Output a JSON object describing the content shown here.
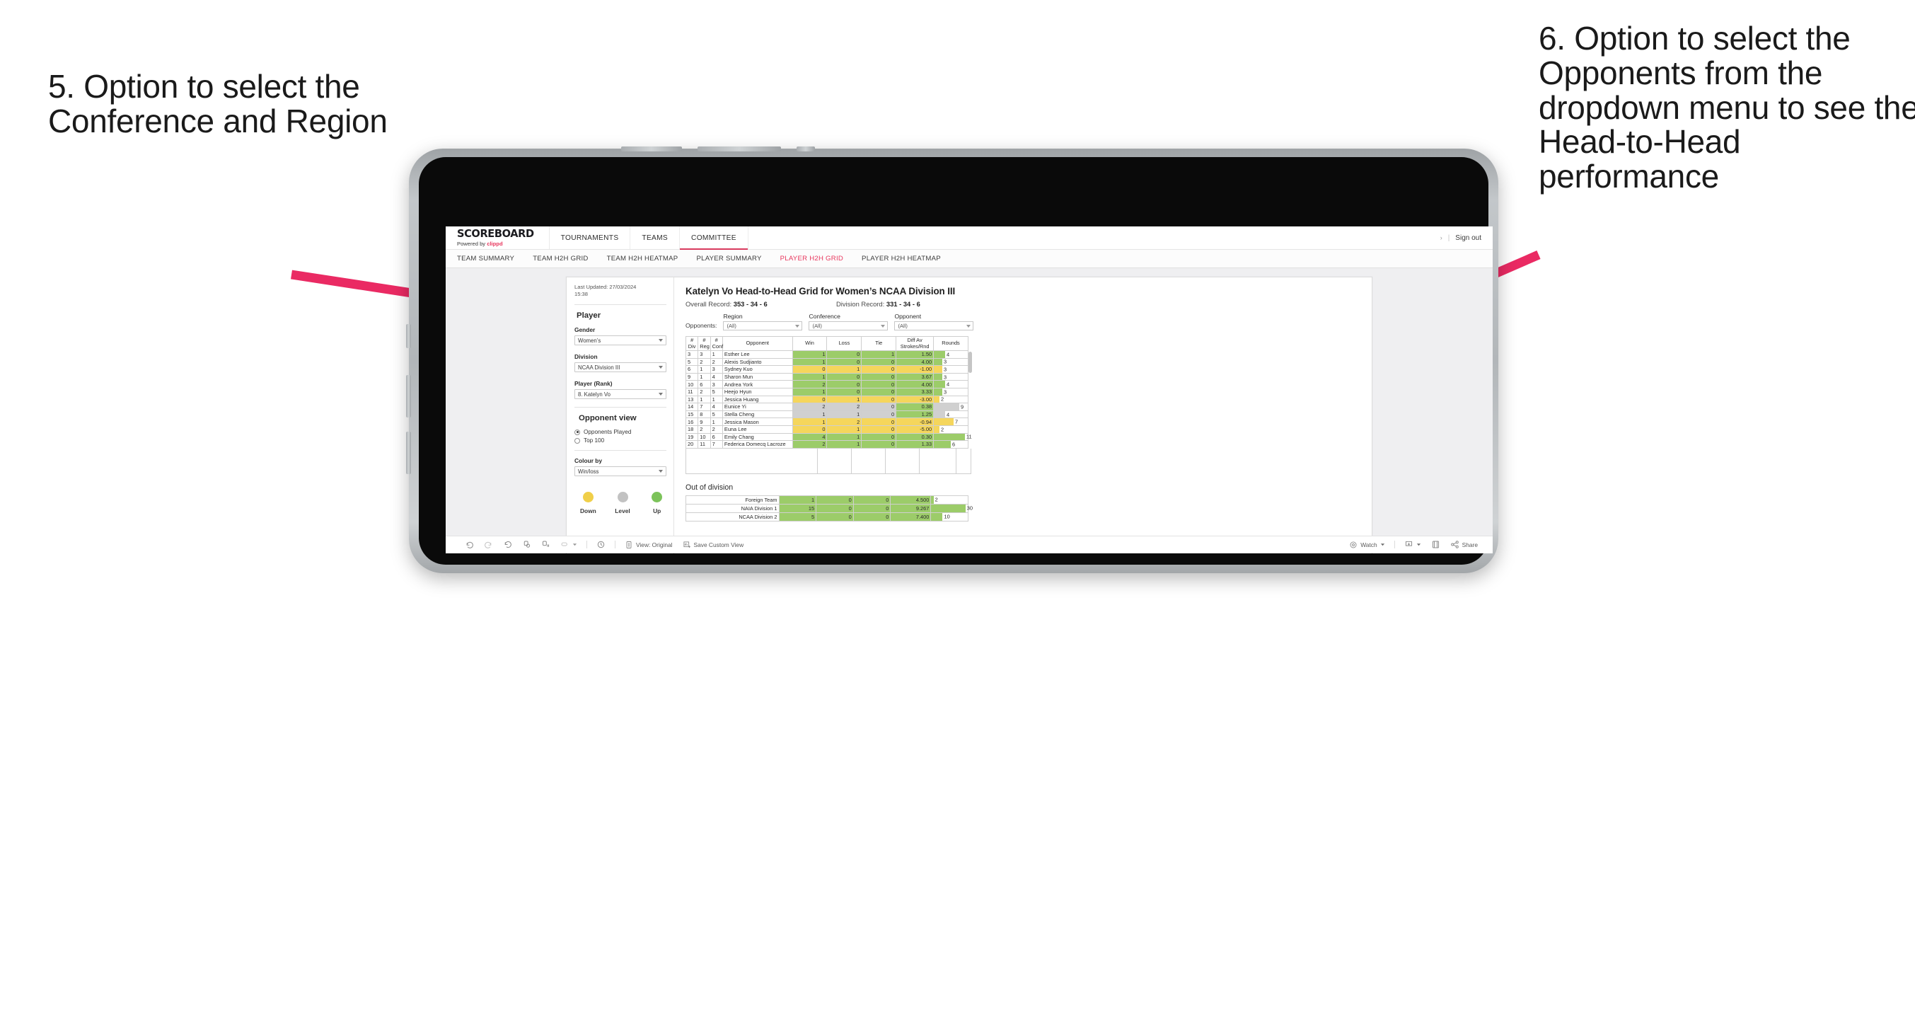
{
  "annotations": {
    "left": "5. Option to select the Conference and Region",
    "right": "6. Option to select the Opponents from the dropdown menu to see the Head-to-Head performance",
    "arrow_color": "#ea2a63"
  },
  "topnav": {
    "brand_title": "SCOREBOARD",
    "brand_powered_prefix": "Powered by ",
    "brand_powered_name": "clippd",
    "items": [
      {
        "label": "TOURNAMENTS",
        "active": false
      },
      {
        "label": "TEAMS",
        "active": false
      },
      {
        "label": "COMMITTEE",
        "active": true
      }
    ],
    "signout_label": "Sign out",
    "signout_chevron": "›",
    "signout_divider": "|"
  },
  "tabbar": {
    "tabs": [
      {
        "label": "TEAM SUMMARY",
        "active": false
      },
      {
        "label": "TEAM H2H GRID",
        "active": false
      },
      {
        "label": "TEAM H2H HEATMAP",
        "active": false
      },
      {
        "label": "PLAYER SUMMARY",
        "active": false
      },
      {
        "label": "PLAYER H2H GRID",
        "active": true
      },
      {
        "label": "PLAYER H2H HEATMAP",
        "active": false
      }
    ],
    "active_color": "#e8365d"
  },
  "panel": {
    "last_updated": "Last Updated: 27/03/2024",
    "last_updated_time": "15:38",
    "player_heading": "Player",
    "gender": {
      "label": "Gender",
      "value": "Women’s"
    },
    "division": {
      "label": "Division",
      "value": "NCAA Division III"
    },
    "player_rank": {
      "label": "Player (Rank)",
      "value": "8. Katelyn Vo"
    },
    "opponent_view": {
      "heading": "Opponent view",
      "options": [
        {
          "label": "Opponents Played",
          "selected": true
        },
        {
          "label": "Top 100",
          "selected": false
        }
      ]
    },
    "colour_by": {
      "label": "Colour by",
      "value": "Win/loss"
    },
    "legend": [
      {
        "label": "Down",
        "color": "#f0cf49"
      },
      {
        "label": "Level",
        "color": "#c2c2c2"
      },
      {
        "label": "Up",
        "color": "#7cc35a"
      }
    ]
  },
  "main": {
    "title": "Katelyn Vo Head-to-Head Grid for Women’s NCAA Division III",
    "overall_record_label": "Overall Record:",
    "overall_record_value": "353 - 34 - 6",
    "division_record_label": "Division Record:",
    "division_record_value": "331 - 34 - 6",
    "opponents_label": "Opponents:",
    "filters": [
      {
        "label": "Region",
        "value": "(All)"
      },
      {
        "label": "Conference",
        "value": "(All)"
      },
      {
        "label": "Opponent",
        "value": "(All)"
      }
    ],
    "out_of_division_heading": "Out of division"
  },
  "chart_data": {
    "type": "table",
    "title": "Katelyn Vo Head-to-Head Grid for Women’s NCAA Division III",
    "columns": [
      "# Div",
      "# Reg",
      "# Conf",
      "Opponent",
      "Win",
      "Loss",
      "Tie",
      "Diff Av Strokes/Rnd",
      "Rounds"
    ],
    "header_lines": [
      [
        "#",
        "Div"
      ],
      [
        "#",
        "Reg"
      ],
      [
        "#",
        "Conf"
      ],
      [
        "Opponent"
      ],
      [
        "Win"
      ],
      [
        "Loss"
      ],
      [
        "Tie"
      ],
      [
        "Diff Av",
        "Strokes/Rnd"
      ],
      [
        "Rounds"
      ]
    ],
    "colors": {
      "up": "#9ccc69",
      "down": "#f5d65c",
      "level": "#d0d0d0"
    },
    "rounds_max": 12,
    "rows": [
      {
        "div": "3",
        "reg": "3",
        "conf": "1",
        "opponent": "Esther Lee",
        "win": "1",
        "loss": "0",
        "tie": "1",
        "diff": "1.50",
        "rounds": "4",
        "rounds_val": 4,
        "state": "up"
      },
      {
        "div": "5",
        "reg": "2",
        "conf": "2",
        "opponent": "Alexis Sudjianto",
        "win": "1",
        "loss": "0",
        "tie": "0",
        "diff": "4.00",
        "rounds": "3",
        "rounds_val": 3,
        "state": "up"
      },
      {
        "div": "6",
        "reg": "1",
        "conf": "3",
        "opponent": "Sydney Kuo",
        "win": "0",
        "loss": "1",
        "tie": "0",
        "diff": "-1.00",
        "rounds": "3",
        "rounds_val": 3,
        "state": "down"
      },
      {
        "div": "9",
        "reg": "1",
        "conf": "4",
        "opponent": "Sharon Mun",
        "win": "1",
        "loss": "0",
        "tie": "0",
        "diff": "3.67",
        "rounds": "3",
        "rounds_val": 3,
        "state": "up"
      },
      {
        "div": "10",
        "reg": "6",
        "conf": "3",
        "opponent": "Andrea York",
        "win": "2",
        "loss": "0",
        "tie": "0",
        "diff": "4.00",
        "rounds": "4",
        "rounds_val": 4,
        "state": "up"
      },
      {
        "div": "11",
        "reg": "2",
        "conf": "5",
        "opponent": "Heejo Hyun",
        "win": "1",
        "loss": "0",
        "tie": "0",
        "diff": "3.33",
        "rounds": "3",
        "rounds_val": 3,
        "state": "up"
      },
      {
        "div": "13",
        "reg": "1",
        "conf": "1",
        "opponent": "Jessica Huang",
        "win": "0",
        "loss": "1",
        "tie": "0",
        "diff": "-3.00",
        "rounds": "2",
        "rounds_val": 2,
        "state": "down"
      },
      {
        "div": "14",
        "reg": "7",
        "conf": "4",
        "opponent": "Eunice Yi",
        "win": "2",
        "loss": "2",
        "tie": "0",
        "diff": "0.38",
        "rounds": "9",
        "rounds_val": 9,
        "state": "level",
        "diff_state": "up"
      },
      {
        "div": "15",
        "reg": "8",
        "conf": "5",
        "opponent": "Stella Cheng",
        "win": "1",
        "loss": "1",
        "tie": "0",
        "diff": "1.25",
        "rounds": "4",
        "rounds_val": 4,
        "state": "level",
        "diff_state": "up"
      },
      {
        "div": "16",
        "reg": "9",
        "conf": "1",
        "opponent": "Jessica Mason",
        "win": "1",
        "loss": "2",
        "tie": "0",
        "diff": "-0.94",
        "rounds": "7",
        "rounds_val": 7,
        "state": "down"
      },
      {
        "div": "18",
        "reg": "2",
        "conf": "2",
        "opponent": "Euna Lee",
        "win": "0",
        "loss": "1",
        "tie": "0",
        "diff": "-5.00",
        "rounds": "2",
        "rounds_val": 2,
        "state": "down"
      },
      {
        "div": "19",
        "reg": "10",
        "conf": "6",
        "opponent": "Emily Chang",
        "win": "4",
        "loss": "1",
        "tie": "0",
        "diff": "0.30",
        "rounds": "11",
        "rounds_val": 11,
        "state": "up"
      },
      {
        "div": "20",
        "reg": "11",
        "conf": "7",
        "opponent": "Federica Domecq Lacroze",
        "win": "2",
        "loss": "1",
        "tie": "0",
        "diff": "1.33",
        "rounds": "6",
        "rounds_val": 6,
        "state": "up"
      }
    ],
    "out_of_division": {
      "rounds_max": 32,
      "rows": [
        {
          "name": "Foreign Team",
          "win": "1",
          "loss": "0",
          "tie": "0",
          "diff": "4.500",
          "rounds": "2",
          "rounds_val": 2,
          "state": "up"
        },
        {
          "name": "NAIA Division 1",
          "win": "15",
          "loss": "0",
          "tie": "0",
          "diff": "9.267",
          "rounds": "30",
          "rounds_val": 30,
          "state": "up"
        },
        {
          "name": "NCAA Division 2",
          "win": "5",
          "loss": "0",
          "tie": "0",
          "diff": "7.400",
          "rounds": "10",
          "rounds_val": 10,
          "state": "up"
        }
      ]
    }
  },
  "toolbar": {
    "view_label": "View: Original",
    "save_label": "Save Custom View",
    "watch_label": "Watch",
    "share_label": "Share"
  }
}
